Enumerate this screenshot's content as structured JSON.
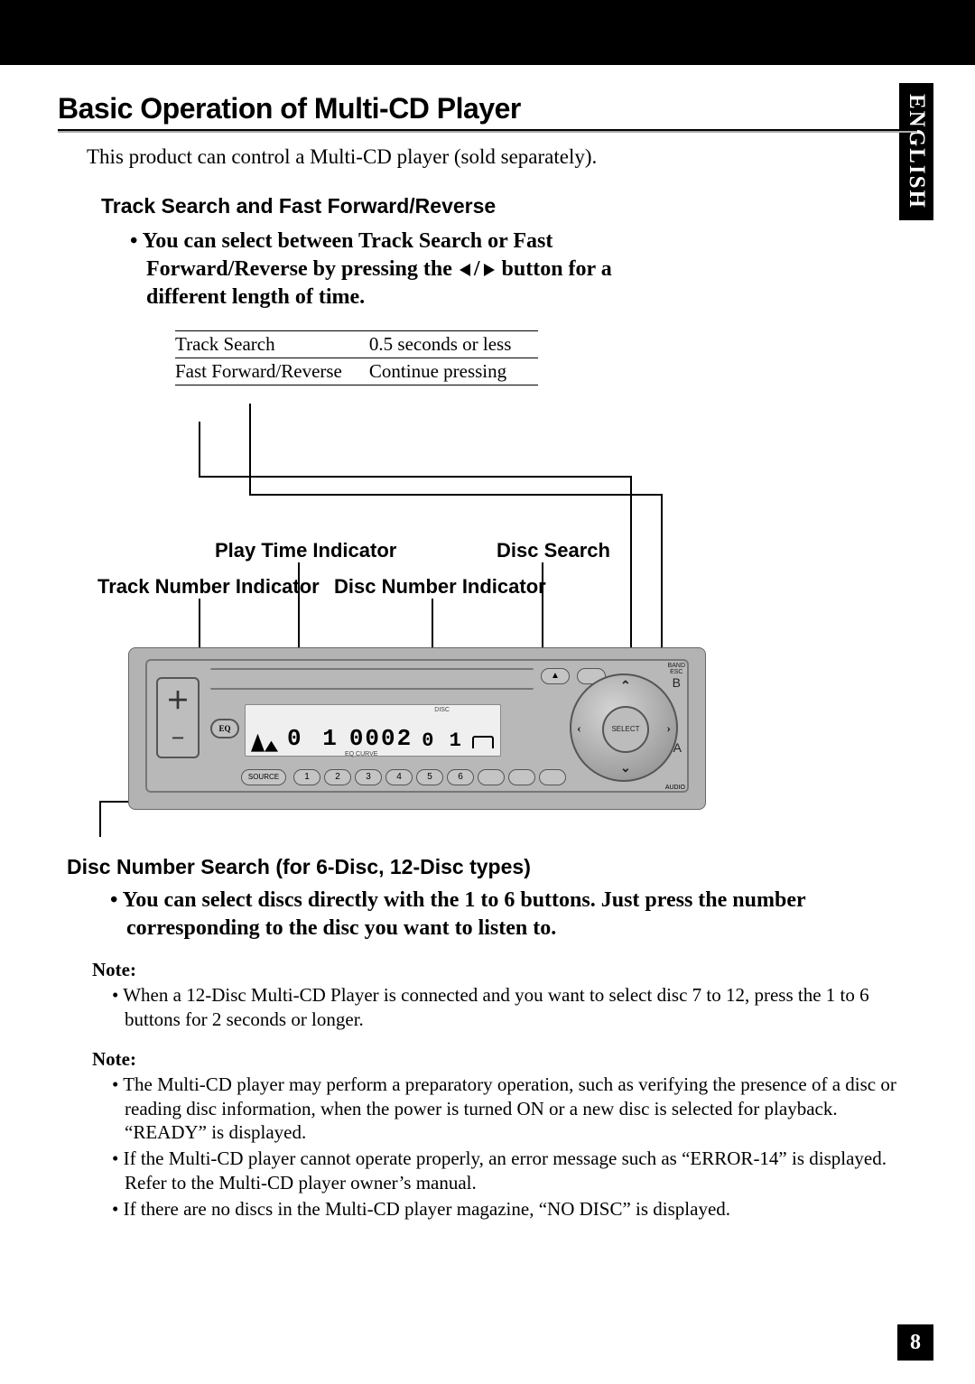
{
  "lang_tab": "ENGLISH",
  "page_title": "Basic Operation of Multi-CD Player",
  "intro": "This product can control a Multi-CD player (sold separately).",
  "section1": {
    "heading": "Track Search and Fast Forward/Reverse",
    "bullet_pre": "You can select between Track Search or Fast Forward/Reverse by pressing the ",
    "bullet_post": " button for a different length of time."
  },
  "timing_table": {
    "rows": [
      {
        "label": "Track Search",
        "value": "0.5 seconds or less"
      },
      {
        "label": "Fast Forward/Reverse",
        "value": "Continue pressing"
      }
    ]
  },
  "callouts": {
    "play_time": "Play Time Indicator",
    "disc_search": "Disc Search",
    "track_number": "Track Number Indicator",
    "disc_number": "Disc Number Indicator"
  },
  "device": {
    "vol_plus": "＋",
    "vol_minus": "−",
    "eq": "EQ",
    "eq_curve": "EQ CURVE",
    "disc_label": "DISC",
    "eject": "▲",
    "dial_center": "SELECT",
    "band_label": "BAND\nESC",
    "band_glyph": "B",
    "a_glyph": "A",
    "audio_label": "AUDIO",
    "source": "SOURCE",
    "display_track": "0 1",
    "display_time": "0002",
    "display_disc": "0 1",
    "numbers": [
      "1",
      "2",
      "3",
      "4",
      "5",
      "6"
    ]
  },
  "section2": {
    "heading": "Disc Number Search (for 6-Disc, 12-Disc types)",
    "bullet": "You can select discs directly with the 1 to 6 buttons. Just press the number corresponding to the disc you want to listen to."
  },
  "note1": {
    "heading": "Note:",
    "items": [
      "When a 12-Disc Multi-CD Player is connected and you want to select disc 7 to 12, press the 1 to 6 buttons for 2 seconds or longer."
    ]
  },
  "note2": {
    "heading": "Note:",
    "items": [
      "The Multi-CD player may perform a preparatory operation, such as verifying the presence of a disc or reading disc information, when the power is turned ON or a new disc is selected for playback. “READY” is displayed.",
      "If the Multi-CD player cannot operate properly, an error message such as “ERROR-14” is displayed. Refer to the Multi-CD player owner’s manual.",
      "If there are no discs in the Multi-CD player magazine, “NO DISC” is displayed."
    ]
  },
  "page_number": "8"
}
